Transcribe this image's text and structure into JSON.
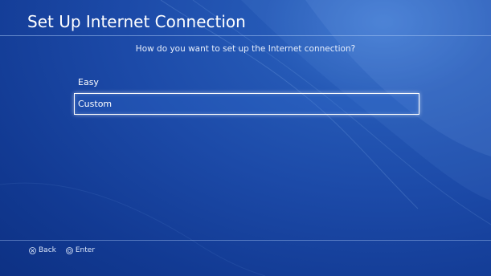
{
  "header": {
    "title": "Set Up Internet Connection"
  },
  "prompt": "How do you want to set up the Internet connection?",
  "options": [
    {
      "label": "Easy",
      "selected": false
    },
    {
      "label": "Custom",
      "selected": true
    }
  ],
  "footer": {
    "back_label": "Back",
    "back_icon": "cross-button-icon",
    "enter_label": "Enter",
    "enter_icon": "circle-button-icon"
  },
  "colors": {
    "background": "#1c4aa8",
    "text": "#ffffff",
    "selection_border": "#ffffff"
  }
}
